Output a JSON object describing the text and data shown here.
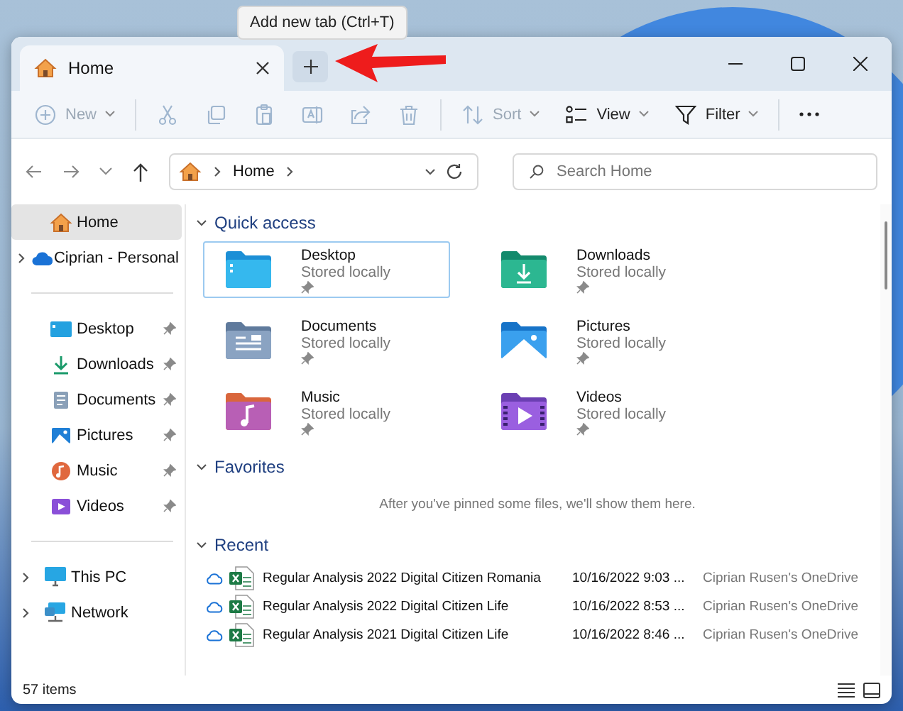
{
  "tooltip": "Add new tab (Ctrl+T)",
  "tabs": [
    {
      "label": "Home",
      "selected": true
    }
  ],
  "toolbar": [
    {
      "kind": "new",
      "label": "New",
      "disabled": true
    },
    {
      "kind": "cut",
      "disabled": true
    },
    {
      "kind": "copy",
      "disabled": true
    },
    {
      "kind": "paste",
      "disabled": true
    },
    {
      "kind": "rename",
      "disabled": true
    },
    {
      "kind": "share",
      "disabled": true
    },
    {
      "kind": "delete",
      "disabled": true
    },
    {
      "kind": "sort",
      "label": "Sort",
      "disabled": true
    },
    {
      "kind": "view",
      "label": "View",
      "disabled": false
    },
    {
      "kind": "filter",
      "label": "Filter",
      "disabled": false
    },
    {
      "kind": "more",
      "disabled": false
    }
  ],
  "address": {
    "crumbs": [
      "Home"
    ]
  },
  "search": {
    "placeholder": "Search Home"
  },
  "sidebar": {
    "groups": [
      [
        {
          "kind": "home",
          "label": "Home",
          "selected": true,
          "expandable": false,
          "pinned": false
        },
        {
          "kind": "cloud",
          "label": "Ciprian - Personal",
          "selected": false,
          "expandable": true,
          "pinned": false
        }
      ],
      [
        {
          "kind": "desktop",
          "label": "Desktop",
          "selected": false,
          "expandable": false,
          "pinned": true
        },
        {
          "kind": "downloads",
          "label": "Downloads",
          "selected": false,
          "expandable": false,
          "pinned": true
        },
        {
          "kind": "documents",
          "label": "Documents",
          "selected": false,
          "expandable": false,
          "pinned": true
        },
        {
          "kind": "pictures",
          "label": "Pictures",
          "selected": false,
          "expandable": false,
          "pinned": true
        },
        {
          "kind": "music",
          "label": "Music",
          "selected": false,
          "expandable": false,
          "pinned": true
        },
        {
          "kind": "videos",
          "label": "Videos",
          "selected": false,
          "expandable": false,
          "pinned": true
        }
      ],
      [
        {
          "kind": "pc",
          "label": "This PC",
          "selected": false,
          "expandable": true,
          "pinned": false
        },
        {
          "kind": "network",
          "label": "Network",
          "selected": false,
          "expandable": true,
          "pinned": false
        }
      ]
    ]
  },
  "quick_access": {
    "title": "Quick access",
    "expanded": true,
    "items": [
      {
        "kind": "desktop",
        "name": "Desktop",
        "status": "Stored locally",
        "pinned": true,
        "selected": true
      },
      {
        "kind": "downloads",
        "name": "Downloads",
        "status": "Stored locally",
        "pinned": true,
        "selected": false
      },
      {
        "kind": "documents",
        "name": "Documents",
        "status": "Stored locally",
        "pinned": true,
        "selected": false
      },
      {
        "kind": "pictures",
        "name": "Pictures",
        "status": "Stored locally",
        "pinned": true,
        "selected": false
      },
      {
        "kind": "music",
        "name": "Music",
        "status": "Stored locally",
        "pinned": true,
        "selected": false
      },
      {
        "kind": "videos",
        "name": "Videos",
        "status": "Stored locally",
        "pinned": true,
        "selected": false
      }
    ]
  },
  "favorites": {
    "title": "Favorites",
    "expanded": true,
    "empty_message": "After you've pinned some files, we'll show them here."
  },
  "recent": {
    "title": "Recent",
    "expanded": true,
    "files": [
      {
        "name": "Regular Analysis 2022 Digital Citizen Romania",
        "modified": "10/16/2022 9:03 ...",
        "location": "Ciprian Rusen's OneDrive"
      },
      {
        "name": "Regular Analysis 2022 Digital Citizen Life",
        "modified": "10/16/2022 8:53 ...",
        "location": "Ciprian Rusen's OneDrive"
      },
      {
        "name": "Regular Analysis 2021 Digital Citizen Life",
        "modified": "10/16/2022 8:46 ...",
        "location": "Ciprian Rusen's OneDrive"
      }
    ]
  },
  "status_bar": {
    "item_count": "57 items"
  }
}
